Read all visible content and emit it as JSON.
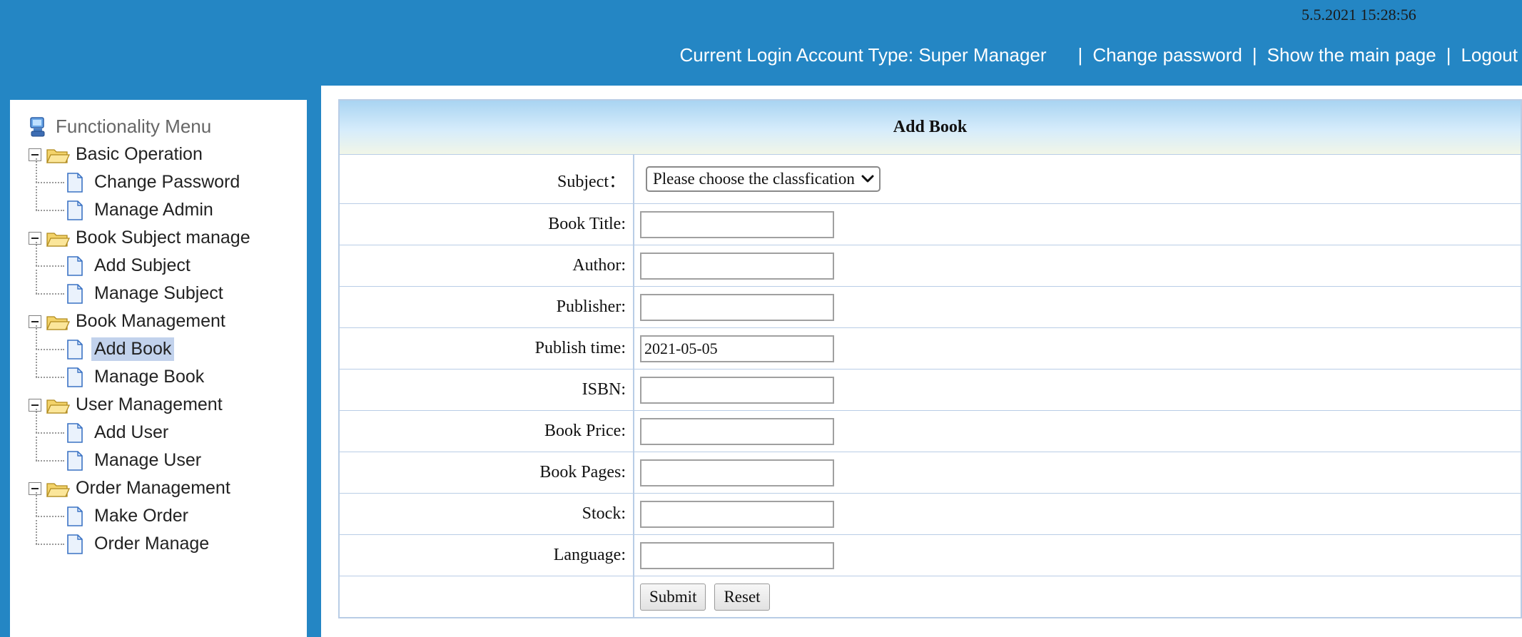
{
  "header": {
    "datetime": "5.5.2021 15:28:56",
    "account_type": "Current Login Account Type: Super Manager",
    "separator": "|",
    "links": [
      "Change password",
      "Show the main page",
      "Logout"
    ]
  },
  "sidebar": {
    "title": "Functionality Menu",
    "groups": [
      {
        "label": "Basic Operation",
        "items": [
          "Change Password",
          "Manage Admin"
        ]
      },
      {
        "label": "Book Subject manage",
        "items": [
          "Add Subject",
          "Manage Subject"
        ]
      },
      {
        "label": "Book Management",
        "items": [
          "Add Book",
          "Manage Book"
        ]
      },
      {
        "label": "User Management",
        "items": [
          "Add User",
          "Manage User"
        ]
      },
      {
        "label": "Order Management",
        "items": [
          "Make Order",
          "Order Manage"
        ]
      }
    ],
    "active_item": "Add Book"
  },
  "form": {
    "title": "Add Book",
    "subject_label": "Subject：",
    "subject_selected": "Please choose the classfication",
    "fields": [
      {
        "label": "Book Title:",
        "value": ""
      },
      {
        "label": "Author:",
        "value": ""
      },
      {
        "label": "Publisher:",
        "value": ""
      },
      {
        "label": "Publish time:",
        "value": "2021-05-05"
      },
      {
        "label": "ISBN:",
        "value": ""
      },
      {
        "label": "Book Price:",
        "value": ""
      },
      {
        "label": "Book Pages:",
        "value": ""
      },
      {
        "label": "Stock:",
        "value": ""
      },
      {
        "label": "Language:",
        "value": ""
      }
    ],
    "submit_label": "Submit",
    "reset_label": "Reset"
  },
  "colors": {
    "header_bg": "#2486c4",
    "active_item_bg": "#c2d2ec",
    "table_border": "#b9cde6"
  }
}
